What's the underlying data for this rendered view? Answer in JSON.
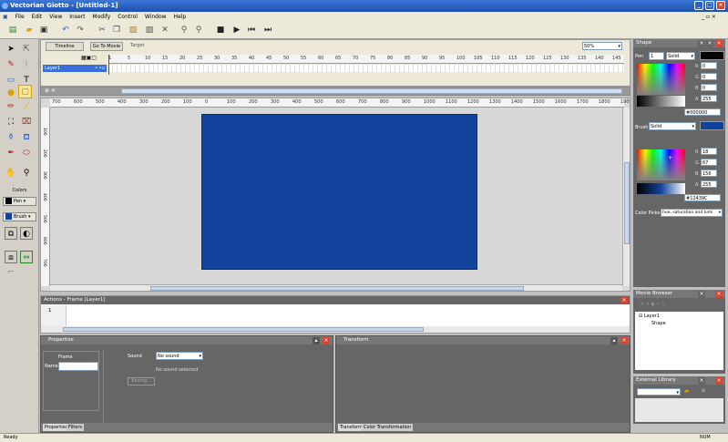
{
  "window": {
    "title": "Vectorian Giotto - [Untitled-1]",
    "status_left": "Ready",
    "status_right": "NUM"
  },
  "menu": [
    "File",
    "Edit",
    "View",
    "Insert",
    "Modify",
    "Control",
    "Window",
    "Help"
  ],
  "timeline": {
    "tab_timeline": "Timeline",
    "goto_movie": "Go To Movie",
    "target": "Target",
    "zoom": "50%",
    "layer": "Layer1",
    "frames": [
      "1",
      "5",
      "10",
      "15",
      "20",
      "25",
      "30",
      "35",
      "40",
      "45",
      "50",
      "55",
      "60",
      "65",
      "70",
      "75",
      "80",
      "85",
      "90",
      "95",
      "100",
      "105",
      "110",
      "115",
      "120",
      "125",
      "130",
      "135",
      "140",
      "145"
    ]
  },
  "ruler_top": [
    "700",
    "600",
    "500",
    "400",
    "300",
    "200",
    "100",
    "0",
    "100",
    "200",
    "300",
    "400",
    "500",
    "600",
    "700",
    "800",
    "900",
    "1000",
    "1100",
    "1200",
    "1300",
    "1400",
    "1500",
    "1600",
    "1700",
    "1800",
    "1900"
  ],
  "ruler_left": [
    "100",
    "200",
    "300",
    "400",
    "500",
    "600",
    "700"
  ],
  "tools": {
    "colors_label": "Colors",
    "pen_label": "Pen",
    "brush_label": "Brush"
  },
  "actions": {
    "title": "Actions - Frame [Layer1]",
    "line1": "1"
  },
  "properties": {
    "title": "Properties",
    "frame_label": "Frame",
    "name_label": "Name",
    "sound_label": "Sound",
    "sound_value": "No sound",
    "no_sound_selected": "No sound selected",
    "easing_button": "Easing...",
    "tab_properties": "Properties",
    "tab_filters": "Filters"
  },
  "transform": {
    "title": "Transform",
    "tab_transform": "Transform",
    "tab_color_transformation": "Color Transformation"
  },
  "shape": {
    "title": "Shape",
    "pen_label": "Pen",
    "pen_width": "1",
    "pen_style": "Solid",
    "pen_r": "0",
    "pen_g": "0",
    "pen_b": "0",
    "pen_a": "255",
    "pen_hex": "#000000",
    "brush_label": "Brush",
    "brush_style": "Solid",
    "brush_r": "18",
    "brush_g": "67",
    "brush_b": "156",
    "brush_a": "255",
    "brush_hex": "#12439C",
    "color_picker_label": "Color Picker",
    "color_picker_mode": "hue, saturation and lumi",
    "colors": {
      "pen": "#000000",
      "brush": "#12439c"
    }
  },
  "movie_browser": {
    "title": "Movie Browser",
    "tree": [
      "Layer1",
      "Shape"
    ]
  },
  "external_library": {
    "title": "External Library"
  }
}
